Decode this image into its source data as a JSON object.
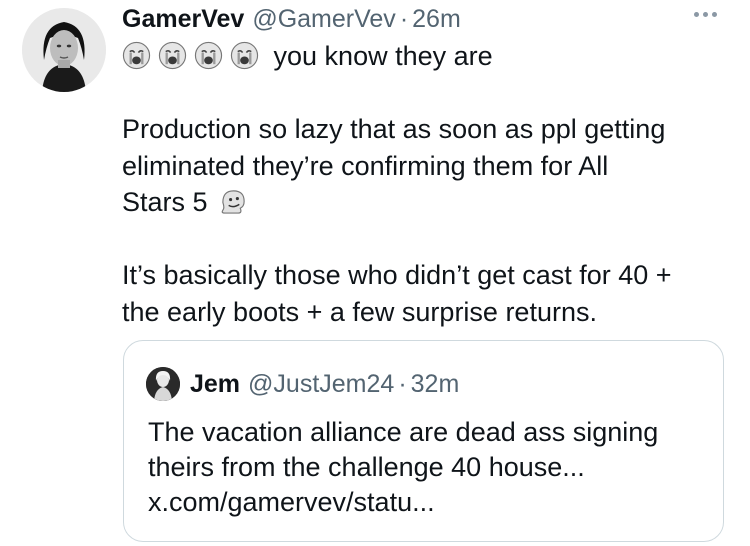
{
  "post": {
    "display_name": "GamerVev",
    "handle": "@GamerVev",
    "separator": "·",
    "time": "26m",
    "more_icon": "more-horizontal-icon",
    "line1_text": "you know they are",
    "line1_emojis": [
      "loudly-crying-face",
      "loudly-crying-face",
      "loudly-crying-face",
      "loudly-crying-face"
    ],
    "para2": [
      "Production so lazy that as soon as ppl getting",
      "eliminated they’re confirming them for All",
      "Stars 5"
    ],
    "para2_emoji": "melting-face",
    "para3": [
      "It’s basically those who didn’t get cast for 40 +",
      "the early boots + a few surprise returns."
    ]
  },
  "quote": {
    "display_name": "Jem",
    "handle": "@JustJem24",
    "separator": "·",
    "time": "32m",
    "lines": [
      "The vacation alliance are dead ass signing",
      "theirs from the challenge 40 house...",
      "x.com/gamervev/statu..."
    ]
  },
  "colors": {
    "text": "#0f1419",
    "secondary": "#536471",
    "border": "#cfd9de"
  }
}
